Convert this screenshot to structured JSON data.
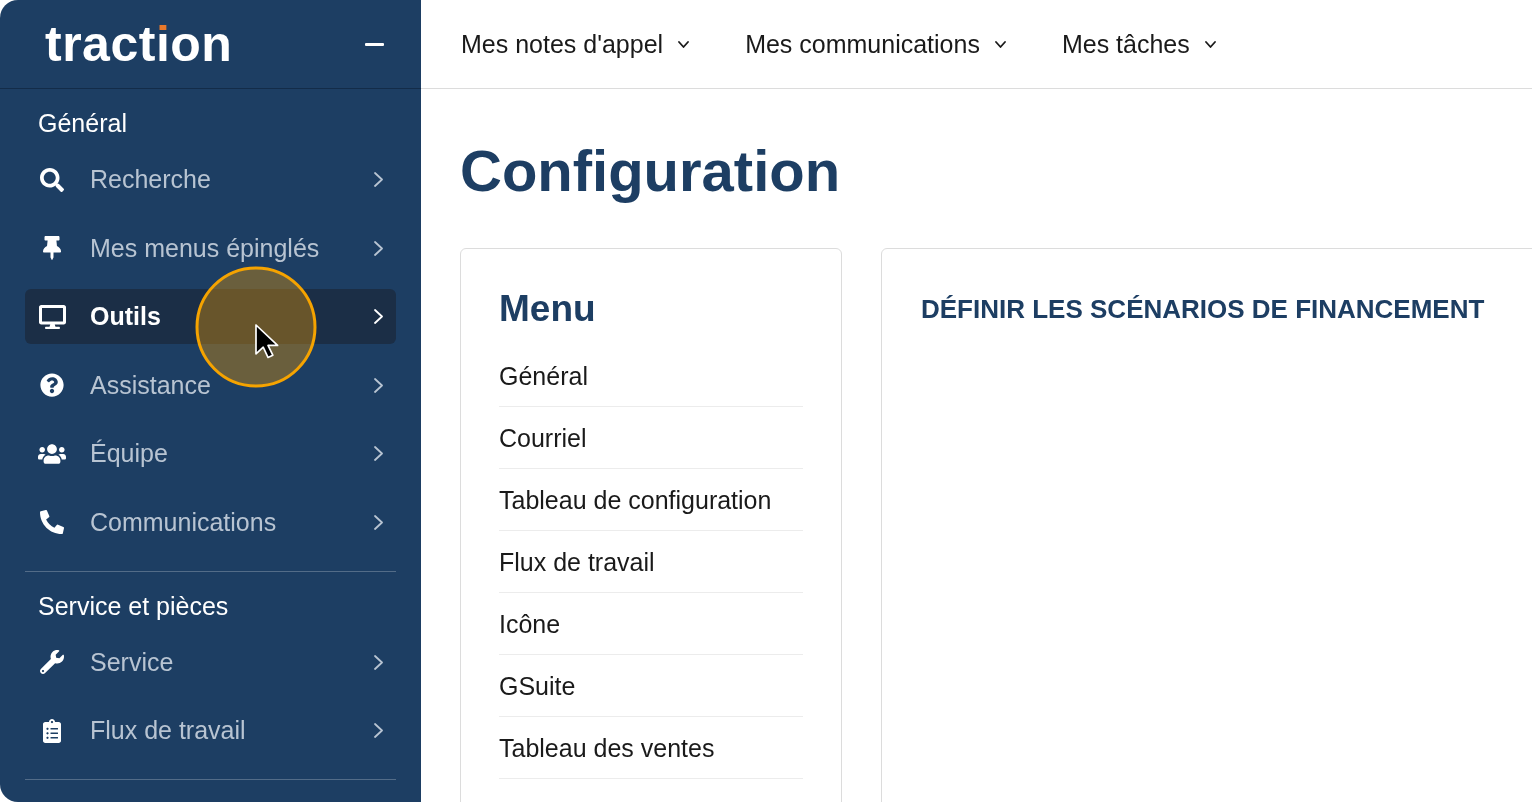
{
  "sidebar": {
    "logo": {
      "before": "tract",
      "accent": "i",
      "after": "on"
    },
    "sections": [
      {
        "title": "Général",
        "items": [
          {
            "label": "Recherche",
            "selected": false
          },
          {
            "label": "Mes menus épinglés",
            "selected": false
          },
          {
            "label": "Outils",
            "selected": true
          },
          {
            "label": "Assistance",
            "selected": false
          },
          {
            "label": "Équipe",
            "selected": false
          },
          {
            "label": "Communications",
            "selected": false
          }
        ]
      },
      {
        "title": "Service et pièces",
        "items": [
          {
            "label": "Service",
            "selected": false
          },
          {
            "label": "Flux de travail",
            "selected": false
          }
        ]
      }
    ]
  },
  "top_nav": [
    "Mes notes d'appel",
    "Mes communications",
    "Mes tâches"
  ],
  "page_title": "Configuration",
  "menu_card": {
    "title": "Menu",
    "items": [
      "Général",
      "Courriel",
      "Tableau de configuration",
      "Flux de travail",
      "Icône",
      "GSuite",
      "Tableau des ventes"
    ]
  },
  "detail_card": {
    "title": "DÉFINIR LES SCÉNARIOS DE FINANCEMENT"
  }
}
